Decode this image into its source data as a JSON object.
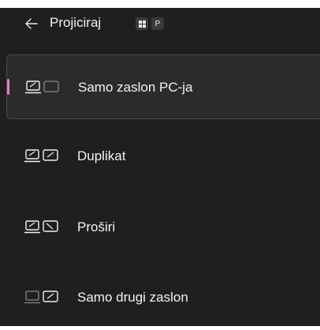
{
  "flyout": {
    "title": "Projiciraj",
    "shortcut": {
      "win_key_icon": "windows-logo-icon",
      "letter_key": "P"
    },
    "back_icon": "back-arrow-icon"
  },
  "options": [
    {
      "label": "Samo zaslon PC-ja",
      "icon": "pc-screen-only-icon",
      "selected": true
    },
    {
      "label": "Duplikat",
      "icon": "duplicate-icon",
      "selected": false
    },
    {
      "label": "Proširi",
      "icon": "extend-icon",
      "selected": false
    },
    {
      "label": "Samo drugi zaslon",
      "icon": "second-screen-only-icon",
      "selected": false
    }
  ],
  "colors": {
    "background": "#1f1f1f",
    "selected_bg": "#2b2b2b",
    "accent": "#e680c8",
    "text": "#f2f2f2"
  }
}
